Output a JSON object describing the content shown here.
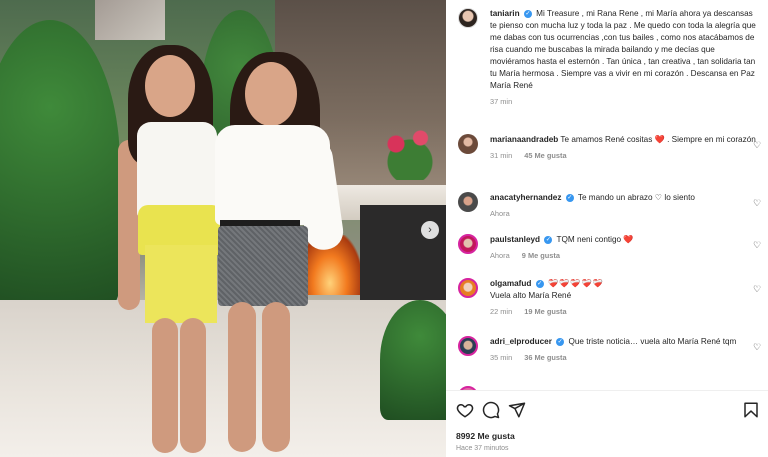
{
  "post": {
    "author": "tanіarin",
    "caption": "Mi Treasure , mi Rana Rene , mi María ahora ya descansas te pienso con mucha luz y toda la paz . Me quedo con toda la alegría que me dabas con tus ocurrencias ,con tus bailes , como nos atacábamos de risa cuando me buscabas la mirada bailando y me decías que moviéramos hasta el esternón . Tan única , tan creativa , tan solidaria tan tu María hermosa . Siempre vas a vivir en mi corazón . Descansa en Paz María René",
    "time": "37 min"
  },
  "comments": [
    {
      "user": "marianaandradeb",
      "verified": false,
      "text": "Te amamos René cositas ❤️ . Siempre en mi corazón",
      "time": "31 min",
      "likes": "45 Me gusta"
    },
    {
      "user": "anacatyhernandez",
      "verified": true,
      "text": "Te mando un abrazo ♡ lo siento",
      "time": "Ahora",
      "likes": ""
    },
    {
      "user": "paulstanleyd",
      "verified": true,
      "text": "TQM neni contigo ❤️",
      "time": "Ahora",
      "likes": "9 Me gusta"
    },
    {
      "user": "olgamafud",
      "verified": true,
      "text": "❤️‍🩹❤️‍🩹❤️‍🩹❤️‍🩹❤️‍🩹",
      "text2": "Vuela alto María René",
      "time": "22 min",
      "likes": "19 Me gusta"
    },
    {
      "user": "adri_elproducer",
      "verified": true,
      "text": "Que triste noticia… vuela alto María René tqm",
      "time": "35 min",
      "likes": "36 Me gusta"
    }
  ],
  "stats": {
    "likes": "8992 Me gusta",
    "posted": "Hace 37 minutos"
  },
  "icons": {
    "like": "heart-outline-icon",
    "comment": "speech-bubble-icon",
    "share": "paper-plane-icon",
    "save": "bookmark-icon",
    "next": "chevron-right-icon"
  }
}
